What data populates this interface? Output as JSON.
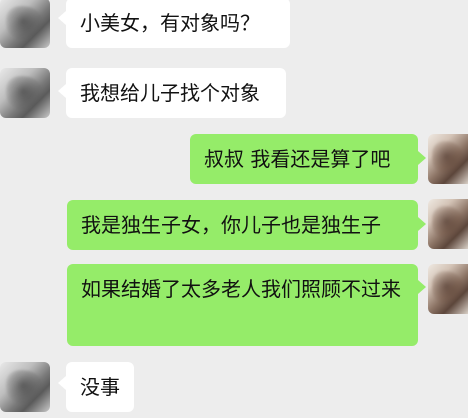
{
  "messages": [
    {
      "side": "left",
      "text": "小美女，有对象吗？"
    },
    {
      "side": "left",
      "text": "我想给儿子找个对象"
    },
    {
      "side": "right",
      "text": "叔叔 我看还是算了吧"
    },
    {
      "side": "right",
      "text": "我是独生子女，你儿子也是独生子"
    },
    {
      "side": "right",
      "text": "如果结婚了太多老人我们照顾不过来"
    },
    {
      "side": "left",
      "text": "没事"
    }
  ],
  "colors": {
    "background": "#ededed",
    "incoming_bubble": "#ffffff",
    "outgoing_bubble": "#95ec69"
  }
}
